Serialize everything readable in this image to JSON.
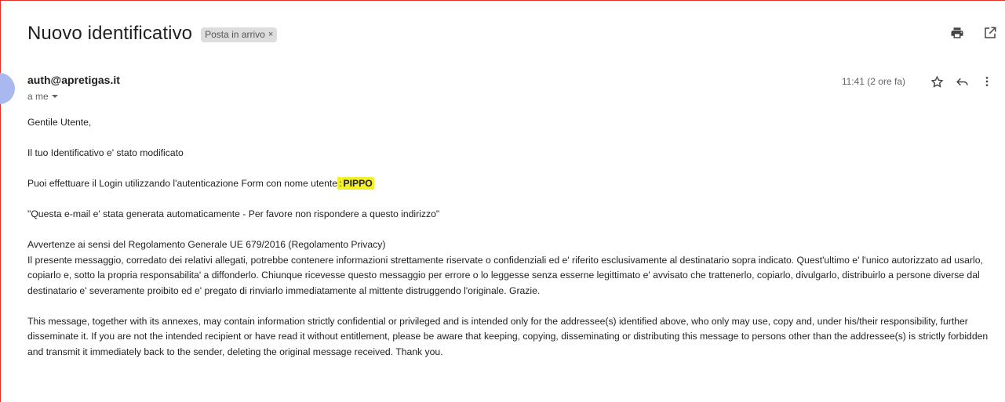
{
  "subject": "Nuovo identificativo",
  "label_chip": {
    "label": "Posta in arrivo",
    "remove": "×"
  },
  "top_actions": {
    "print_icon": "print-icon",
    "open_new_window_icon": "open-in-new-icon"
  },
  "sender": "auth@apretigas.it",
  "recipient": "a me",
  "time": "11:41 (2 ore fa)",
  "body": {
    "greeting": "Gentile Utente,",
    "line1": "Il tuo Identificativo e' stato modificato",
    "line2_prefix": "Puoi effettuare il Login utilizzando l'autenticazione Form con nome utente",
    "line2_colon": ":",
    "username": "PIPPO",
    "auto_notice": "\"Questa e-mail e' stata generata automaticamente - Per favore non rispondere a questo indirizzo\"",
    "privacy_title": "Avvertenze ai sensi del Regolamento Generale UE 679/2016 (Regolamento Privacy)",
    "privacy_it": "Il presente messaggio, corredato dei relativi allegati, potrebbe contenere informazioni strettamente riservate o confidenziali ed e' riferito esclusivamente al destinatario sopra indicato. Quest'ultimo e' l'unico autorizzato ad usarlo, copiarlo e, sotto la propria responsabilita' a diffonderlo. Chiunque ricevesse questo messaggio per errore o lo leggesse senza esserne legittimato e' avvisato che trattenerlo, copiarlo, divulgarlo, distribuirlo a persone diverse dal destinatario e' severamente proibito ed e' pregato di rinviarlo immediatamente al mittente distruggendo l'originale. Grazie.",
    "privacy_en": "This message, together with its annexes, may contain information strictly confidential or privileged and is intended only for the addressee(s) identified above, who only may use, copy and, under his/their responsibility, further disseminate it. If you are not the intended recipient or have read it without entitlement, please be aware that keeping, copying, disseminating or distributing this message to persons other than the addressee(s) is strictly forbidden and transmit it immediately back to the sender, deleting the original message received. Thank you."
  },
  "colors": {
    "highlight": "#f5ee2b",
    "avatar": "#a9b8ef",
    "frame": "#e3322b"
  }
}
